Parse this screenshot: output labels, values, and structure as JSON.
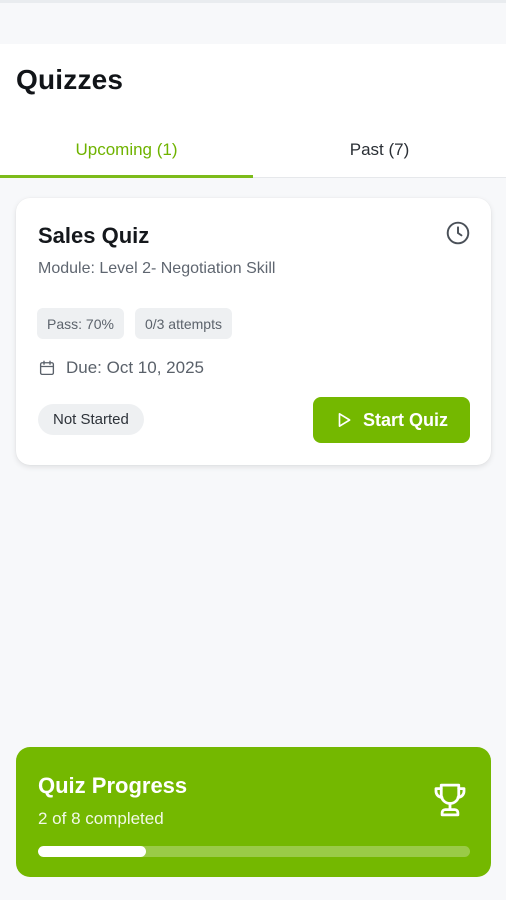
{
  "header": {
    "title": "Quizzes",
    "tabs": [
      {
        "label": "Upcoming (1)",
        "active": true
      },
      {
        "label": "Past (7)",
        "active": false
      }
    ]
  },
  "quiz": {
    "title": "Sales Quiz",
    "module": "Module: Level 2- Negotiation Skill",
    "pass": "Pass: 70%",
    "attempts": "0/3 attempts",
    "due": "Due: Oct 10, 2025",
    "status": "Not Started",
    "action_label": "Start Quiz",
    "icons": {
      "corner": "clock-icon",
      "due": "calendar-icon",
      "action": "play-icon"
    }
  },
  "progress": {
    "title": "Quiz Progress",
    "summary": "2 of 8 completed",
    "completed": 2,
    "total": 8,
    "icon": "trophy-icon"
  },
  "colors": {
    "accent": "#74b800",
    "tab_active": "#6fb300",
    "chip_bg": "#eef0f2",
    "background": "#f7f8fa"
  }
}
